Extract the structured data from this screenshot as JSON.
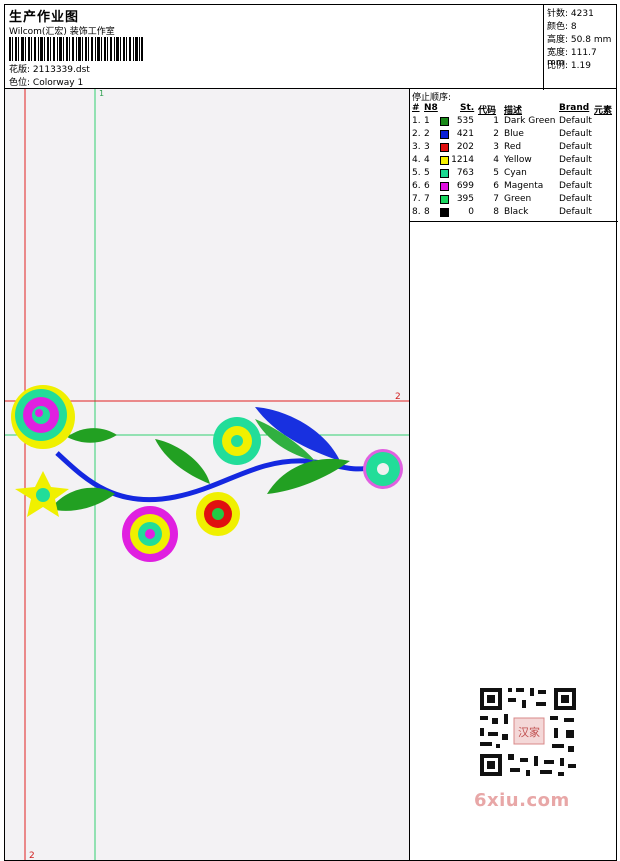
{
  "header": {
    "title": "生产作业图",
    "company": "Wilcom(汇宏) 装饰工作室",
    "design_label": "花版:",
    "design_value": "2113339.dst",
    "colorway_label": "色位:",
    "colorway_value": "Colorway 1"
  },
  "stats": [
    {
      "label": "针数:",
      "value": "4231"
    },
    {
      "label": "颜色:",
      "value": "8"
    },
    {
      "label": "高度:",
      "value": "50.8 mm"
    },
    {
      "label": "宽度:",
      "value": "111.7 mm"
    },
    {
      "label": "比例:",
      "value": "1.19"
    }
  ],
  "markers": {
    "v1": "1",
    "h2": "2",
    "v2": "2"
  },
  "stop_sequence": {
    "title": "停止顺序:",
    "headers": {
      "idx": "#",
      "no": "N8",
      "st": "St.",
      "code": "代码",
      "desc": "描述",
      "brand": "Brand",
      "element": "元素"
    },
    "rows": [
      {
        "idx": "1.",
        "no": "1",
        "color": "#1a8a1a",
        "st": "535",
        "code": "1",
        "desc": "Dark Green",
        "brand": "Default"
      },
      {
        "idx": "2.",
        "no": "2",
        "color": "#0a20d8",
        "st": "421",
        "code": "2",
        "desc": "Blue",
        "brand": "Default"
      },
      {
        "idx": "3.",
        "no": "3",
        "color": "#e01010",
        "st": "202",
        "code": "3",
        "desc": "Red",
        "brand": "Default"
      },
      {
        "idx": "4.",
        "no": "4",
        "color": "#f5f000",
        "st": "1214",
        "code": "4",
        "desc": "Yellow",
        "brand": "Default"
      },
      {
        "idx": "5.",
        "no": "5",
        "color": "#19d890",
        "st": "763",
        "code": "5",
        "desc": "Cyan",
        "brand": "Default"
      },
      {
        "idx": "6.",
        "no": "6",
        "color": "#e010e0",
        "st": "699",
        "code": "6",
        "desc": "Magenta",
        "brand": "Default"
      },
      {
        "idx": "7.",
        "no": "7",
        "color": "#19d860",
        "st": "395",
        "code": "7",
        "desc": "Green",
        "brand": "Default"
      },
      {
        "idx": "8.",
        "no": "8",
        "color": "#000000",
        "st": "0",
        "code": "8",
        "desc": "Black",
        "brand": "Default"
      }
    ]
  },
  "watermark": {
    "text": "6xiu.com",
    "seal_text": "汉家"
  }
}
